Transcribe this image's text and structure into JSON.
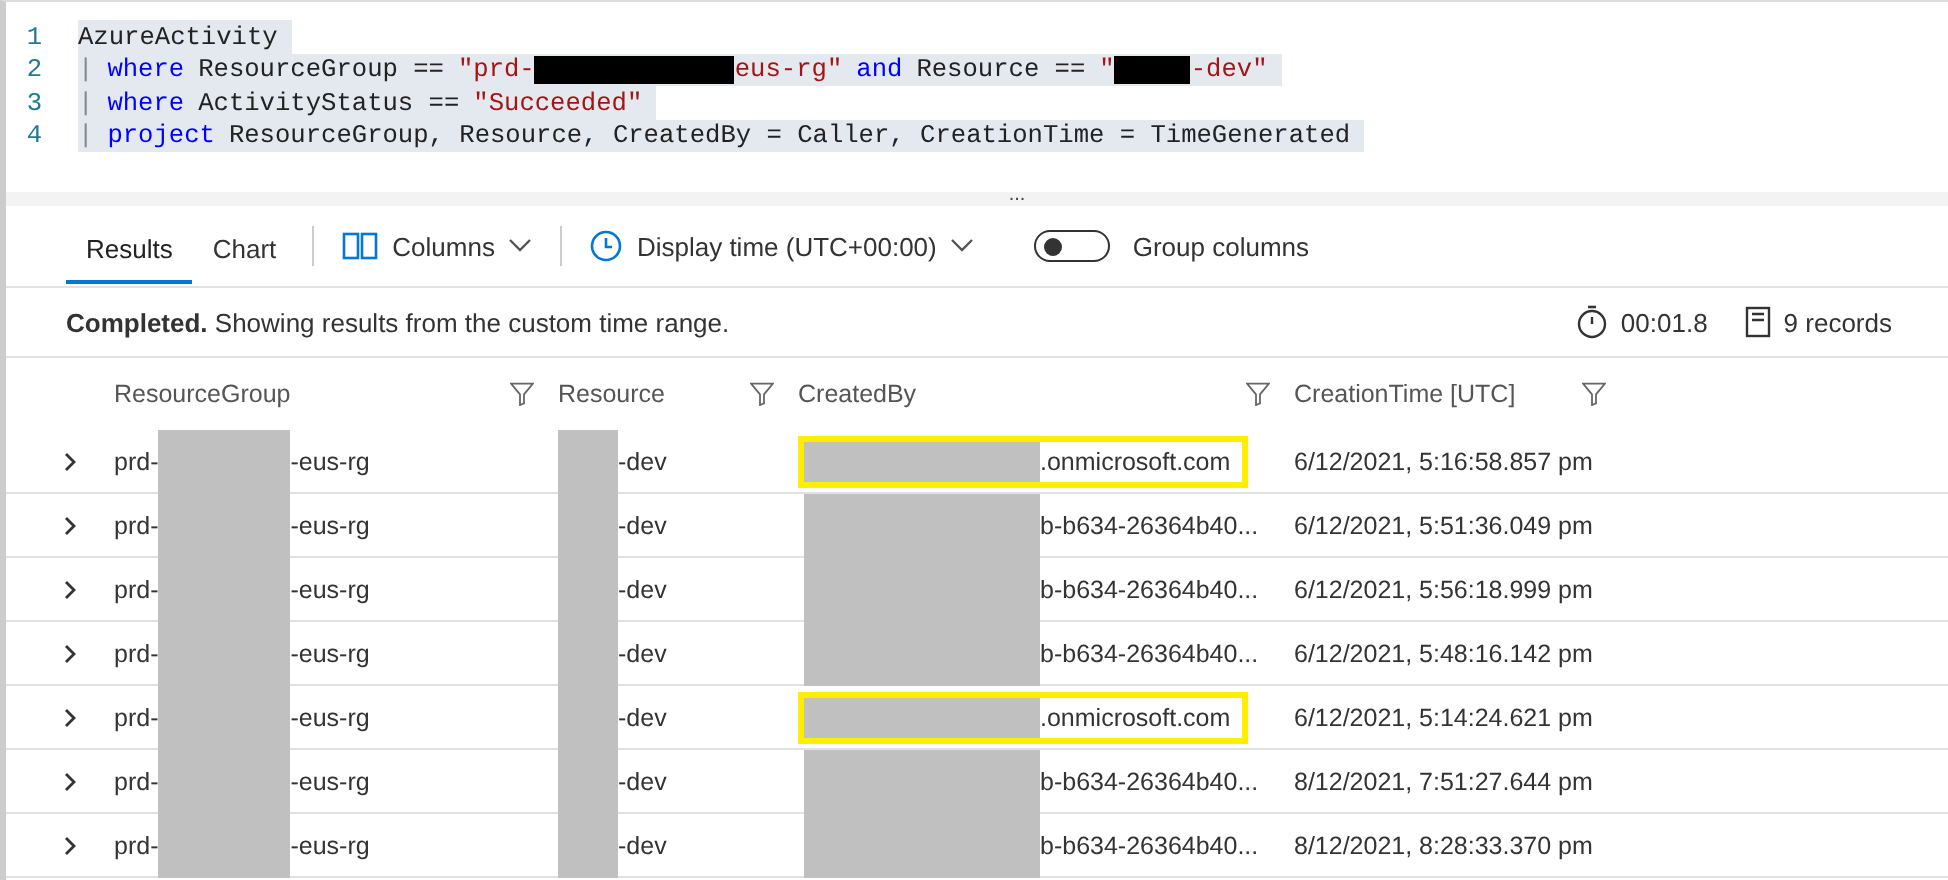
{
  "editor": {
    "lines": [
      {
        "number": "1",
        "tokens": [
          {
            "kind": "plain",
            "text": "AzureActivity"
          }
        ]
      },
      {
        "number": "2",
        "tokens": [
          {
            "kind": "pipe",
            "text": "|"
          },
          {
            "kind": "keyword",
            "text": "where"
          },
          {
            "kind": "plain",
            "text": "ResourceGroup =="
          },
          {
            "kind": "string",
            "text": "\"prd-"
          },
          {
            "kind": "redacted"
          },
          {
            "kind": "string",
            "text": "eus-rg\""
          },
          {
            "kind": "keyword",
            "text": "and"
          },
          {
            "kind": "plain",
            "text": "Resource =="
          },
          {
            "kind": "string",
            "text": "\""
          },
          {
            "kind": "redacted-short"
          },
          {
            "kind": "string",
            "text": "-dev\""
          }
        ]
      },
      {
        "number": "3",
        "tokens": [
          {
            "kind": "pipe",
            "text": "|"
          },
          {
            "kind": "keyword",
            "text": "where"
          },
          {
            "kind": "plain",
            "text": "ActivityStatus =="
          },
          {
            "kind": "string",
            "text": "\"Succeeded\""
          }
        ]
      },
      {
        "number": "4",
        "tokens": [
          {
            "kind": "pipe",
            "text": "|"
          },
          {
            "kind": "keyword",
            "text": "project"
          },
          {
            "kind": "plain",
            "text": "ResourceGroup, Resource, CreatedBy = Caller, CreationTime = TimeGenerated"
          }
        ]
      }
    ],
    "splitter": "..."
  },
  "tabs": [
    {
      "label": "Results",
      "selected": true
    },
    {
      "label": "Chart",
      "selected": false
    }
  ],
  "toolbar": {
    "columns": "Columns",
    "display_time": "Display time (UTC+00:00)",
    "group_columns": {
      "label": "Group columns",
      "on": false
    }
  },
  "status": {
    "state": "Completed.",
    "message": "Showing results from the custom time range.",
    "duration": "00:01.8",
    "records": "9 records"
  },
  "table": {
    "columns": [
      "ResourceGroup",
      "Resource",
      "CreatedBy",
      "CreationTime [UTC]"
    ],
    "rows": [
      {
        "resource_group": [
          "prd-",
          "-eus-rg"
        ],
        "resource": "-dev",
        "created_by": ".onmicrosoft.com",
        "highlighted": true,
        "creation_time": "6/12/2021, 5:16:58.857 pm"
      },
      {
        "resource_group": [
          "prd-",
          "-eus-rg"
        ],
        "resource": "-dev",
        "created_by": "b-b634-26364b40...",
        "highlighted": false,
        "creation_time": "6/12/2021, 5:51:36.049 pm"
      },
      {
        "resource_group": [
          "prd-",
          "-eus-rg"
        ],
        "resource": "-dev",
        "created_by": "b-b634-26364b40...",
        "highlighted": false,
        "creation_time": "6/12/2021, 5:56:18.999 pm"
      },
      {
        "resource_group": [
          "prd-",
          "-eus-rg"
        ],
        "resource": "-dev",
        "created_by": "b-b634-26364b40...",
        "highlighted": false,
        "creation_time": "6/12/2021, 5:48:16.142 pm"
      },
      {
        "resource_group": [
          "prd-",
          "-eus-rg"
        ],
        "resource": "-dev",
        "created_by": ".onmicrosoft.com",
        "highlighted": true,
        "creation_time": "6/12/2021, 5:14:24.621 pm"
      },
      {
        "resource_group": [
          "prd-",
          "-eus-rg"
        ],
        "resource": "-dev",
        "created_by": "b-b634-26364b40...",
        "highlighted": false,
        "creation_time": "8/12/2021, 7:51:27.644 pm"
      },
      {
        "resource_group": [
          "prd-",
          "-eus-rg"
        ],
        "resource": "-dev",
        "created_by": "b-b634-26364b40...",
        "highlighted": false,
        "creation_time": "8/12/2021, 8:28:33.370 pm"
      }
    ]
  }
}
